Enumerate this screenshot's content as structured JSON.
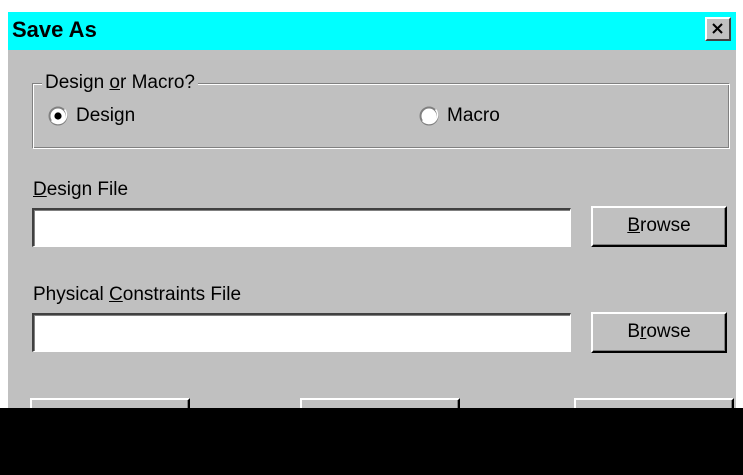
{
  "window": {
    "title": "Save As",
    "close_label": "×"
  },
  "design_or_macro": {
    "legend_prefix": "Design ",
    "legend_accel": "o",
    "legend_suffix": "r Macro?",
    "options": [
      {
        "label": "Design",
        "selected": true
      },
      {
        "label": "Macro",
        "selected": false
      }
    ]
  },
  "design_file": {
    "label_accel": "D",
    "label_rest": "esign File",
    "value": "",
    "browse_accel": "B",
    "browse_rest": "rowse"
  },
  "constraints_file": {
    "label_prefix": "Physical ",
    "label_accel": "C",
    "label_rest": "onstraints File",
    "value": "",
    "browse_prefix": "B",
    "browse_accel": "r",
    "browse_rest": "owse"
  },
  "colors": {
    "title_bar": "#00ffff",
    "dialog_face": "#c0c0c0",
    "occlusion": "#000000"
  }
}
